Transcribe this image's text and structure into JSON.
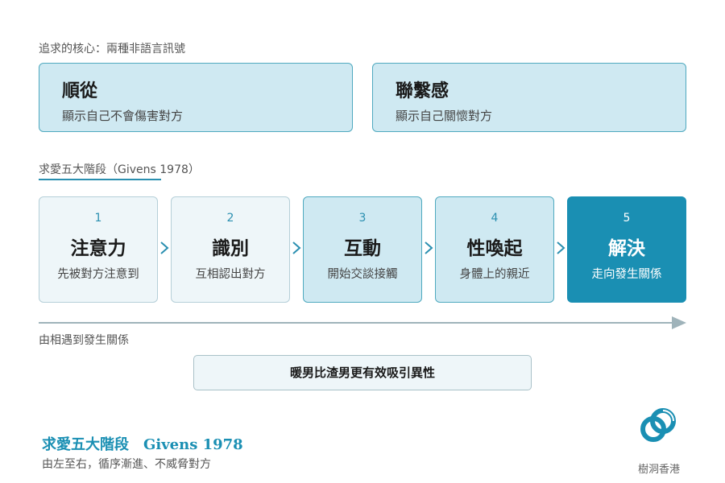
{
  "core": {
    "label": "追求的核心：兩種非語言訊號",
    "signals": [
      {
        "title": "順從",
        "subtitle": "顯示自己不會傷害對方"
      },
      {
        "title": "聯繫感",
        "subtitle": "顯示自己關懷對方"
      }
    ]
  },
  "stages_label": "求愛五大階段（Givens 1978）",
  "stages": [
    {
      "num": "1",
      "title": "注意力",
      "desc": "先被對方注意到"
    },
    {
      "num": "2",
      "title": "識別",
      "desc": "互相認出對方"
    },
    {
      "num": "3",
      "title": "互動",
      "desc": "開始交談接觸"
    },
    {
      "num": "4",
      "title": "性喚起",
      "desc": "身體上的親近"
    },
    {
      "num": "5",
      "title": "解決",
      "desc": "走向發生關係"
    }
  ],
  "timeline_label": "由相遇到發生關係",
  "emphasis": "暖男比渣男更有效吸引異性",
  "footer": {
    "title": "求愛五大階段　Givens 1978",
    "subtitle": "由左至右，循序漸進、不威脅對方"
  },
  "brand": "樹洞香港",
  "colors": {
    "accent": "#1a8fb3",
    "light_box": "#cfe9f2",
    "pale_box": "#eef6f9"
  }
}
